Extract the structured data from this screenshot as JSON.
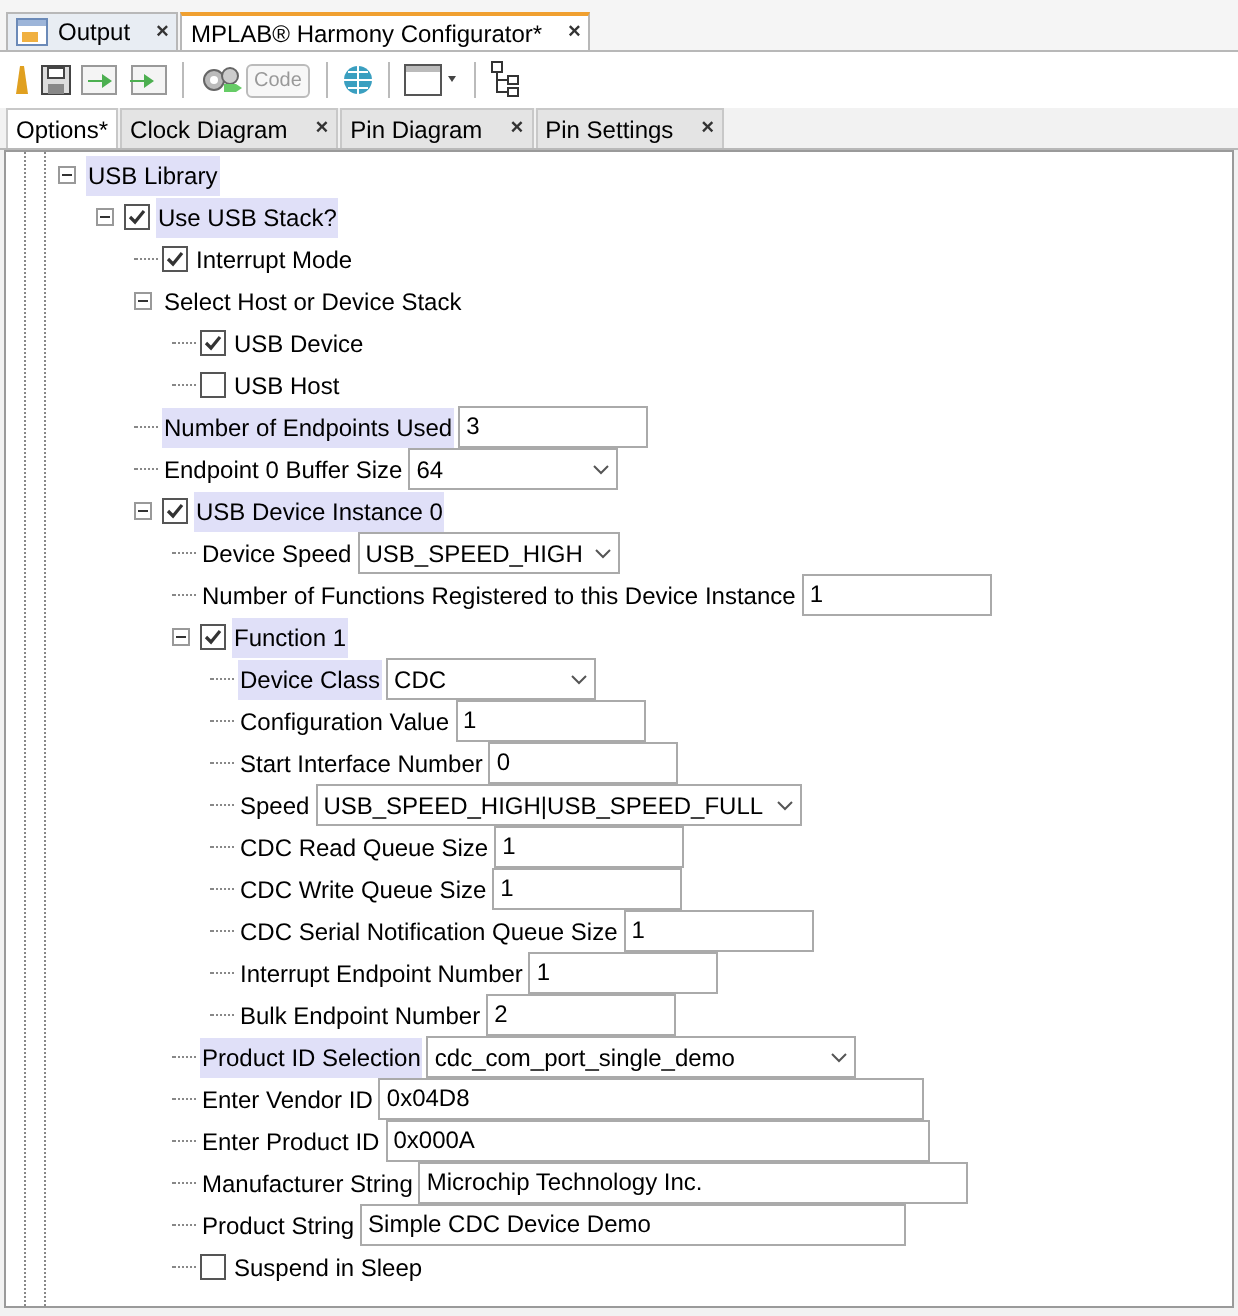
{
  "editor_tabs": [
    {
      "label": "Output",
      "close": "×",
      "selected": false,
      "kind": "output"
    },
    {
      "label": "MPLAB® Harmony Configurator*",
      "close": "×",
      "selected": true,
      "kind": "plain"
    }
  ],
  "toolbar": {
    "code_label": "Code"
  },
  "view_tabs": [
    {
      "label": "Options*",
      "selected": true
    },
    {
      "label": "Clock Diagram",
      "close": "×",
      "selected": false
    },
    {
      "label": "Pin Diagram",
      "close": "×",
      "selected": false
    },
    {
      "label": "Pin Settings",
      "close": "×",
      "selected": false
    }
  ],
  "tree": [
    {
      "kind": "group",
      "label": "USB Library",
      "highlighted": true,
      "children": [
        {
          "kind": "group",
          "label": "Use USB Stack?",
          "checked": true,
          "highlighted": true,
          "children": [
            {
              "kind": "checkbox",
              "label": "Interrupt Mode",
              "checked": true,
              "highlighted": false
            },
            {
              "kind": "group",
              "label": "Select Host or Device Stack",
              "highlighted": false,
              "children": [
                {
                  "kind": "checkbox",
                  "label": "USB Device",
                  "checked": true,
                  "highlighted": false
                },
                {
                  "kind": "checkbox",
                  "label": "USB Host",
                  "checked": false,
                  "highlighted": false
                }
              ]
            },
            {
              "kind": "text",
              "label": "Number of Endpoints Used",
              "value": "3",
              "highlighted": true
            },
            {
              "kind": "combo",
              "label": "Endpoint 0 Buffer Size",
              "value": "64",
              "highlighted": false
            },
            {
              "kind": "group",
              "label": "USB Device Instance 0",
              "checked": true,
              "highlighted": true,
              "children": [
                {
                  "kind": "combo",
                  "label": "Device Speed",
                  "value": "USB_SPEED_HIGH",
                  "highlighted": false
                },
                {
                  "kind": "text",
                  "label": "Number of Functions Registered to this Device Instance",
                  "value": "1",
                  "highlighted": false
                },
                {
                  "kind": "group",
                  "label": "Function 1",
                  "checked": true,
                  "highlighted": true,
                  "children": [
                    {
                      "kind": "combo",
                      "label": "Device Class",
                      "value": "CDC",
                      "highlighted": true
                    },
                    {
                      "kind": "text",
                      "label": "Configuration Value",
                      "value": "1",
                      "highlighted": false
                    },
                    {
                      "kind": "text",
                      "label": "Start Interface Number",
                      "value": "0",
                      "highlighted": false
                    },
                    {
                      "kind": "combo",
                      "label": "Speed",
                      "value": "USB_SPEED_HIGH|USB_SPEED_FULL",
                      "highlighted": false
                    },
                    {
                      "kind": "text",
                      "label": "CDC Read Queue Size",
                      "value": "1",
                      "highlighted": false
                    },
                    {
                      "kind": "text",
                      "label": "CDC Write Queue Size",
                      "value": "1",
                      "highlighted": false
                    },
                    {
                      "kind": "text",
                      "label": "CDC Serial Notification Queue Size",
                      "value": "1",
                      "highlighted": false
                    },
                    {
                      "kind": "text",
                      "label": "Interrupt Endpoint Number",
                      "value": "1",
                      "highlighted": false
                    },
                    {
                      "kind": "text",
                      "label": "Bulk Endpoint Number",
                      "value": "2",
                      "highlighted": false
                    }
                  ]
                },
                {
                  "kind": "combo",
                  "label": "Product ID Selection",
                  "value": "cdc_com_port_single_demo",
                  "highlighted": true
                },
                {
                  "kind": "text",
                  "label": "Enter Vendor ID",
                  "value": "0x04D8",
                  "highlighted": false
                },
                {
                  "kind": "text",
                  "label": "Enter Product ID",
                  "value": "0x000A",
                  "highlighted": false
                },
                {
                  "kind": "text",
                  "label": "Manufacturer String",
                  "value": "Microchip Technology Inc.",
                  "highlighted": false
                },
                {
                  "kind": "text",
                  "label": "Product String",
                  "value": "Simple CDC Device Demo",
                  "highlighted": false
                },
                {
                  "kind": "checkbox",
                  "label": "Suspend in Sleep",
                  "checked": false,
                  "highlighted": false
                }
              ]
            }
          ]
        }
      ]
    }
  ]
}
